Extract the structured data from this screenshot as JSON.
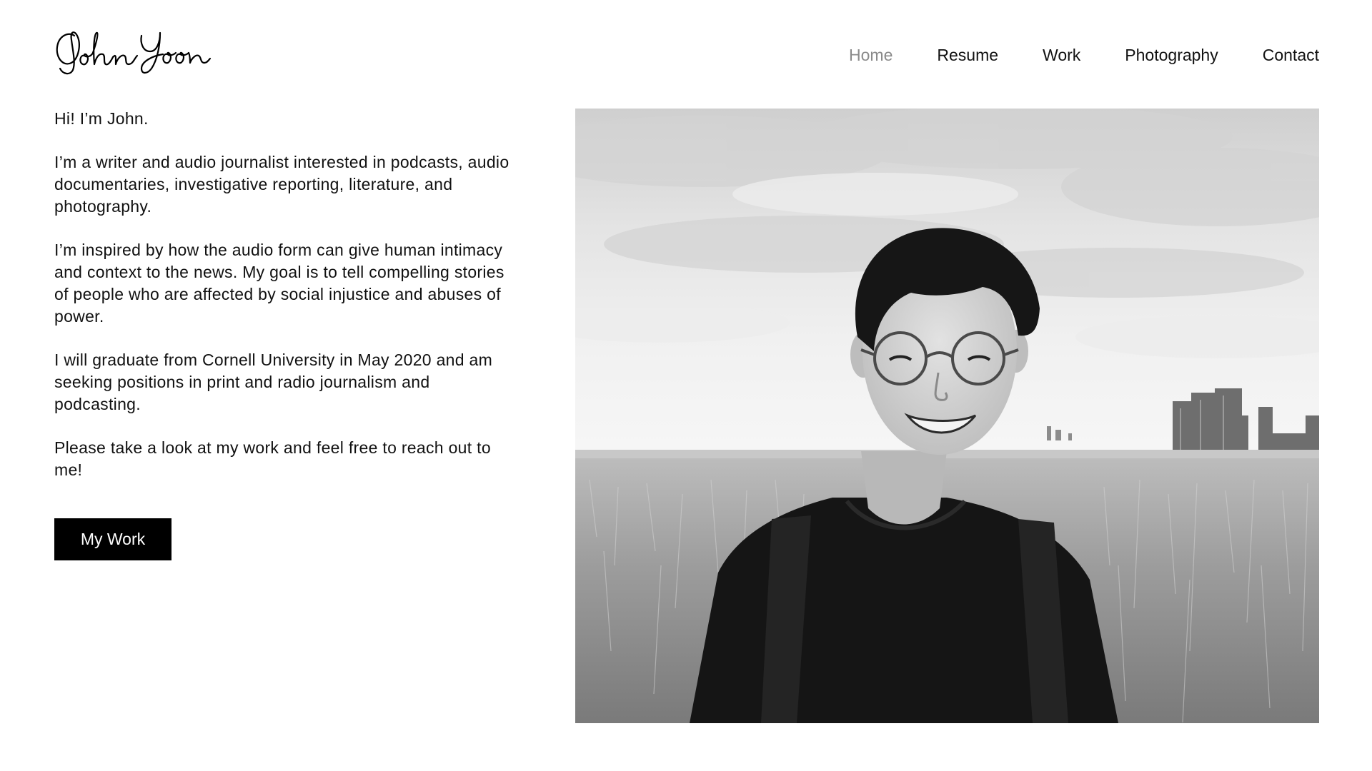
{
  "header": {
    "logo_text": "John Yoon",
    "nav": [
      {
        "label": "Home",
        "active": true
      },
      {
        "label": "Resume",
        "active": false
      },
      {
        "label": "Work",
        "active": false
      },
      {
        "label": "Photography",
        "active": false
      },
      {
        "label": "Contact",
        "active": false
      }
    ]
  },
  "intro": {
    "paragraphs": [
      "Hi! I’m John.",
      "I’m a writer and audio journalist interested in podcasts, audio documentaries, investigative reporting, literature, and photography.",
      "I’m inspired by how the audio form can give human intimacy and context to the news. My goal is to tell compelling stories of people who are affected by social injustice and abuses of power.",
      "I will graduate from Cornell University in May 2020 and am seeking positions in print and radio journalism and podcasting.",
      "Please take a look at my work and feel free to reach out to me!"
    ]
  },
  "cta": {
    "label": "My Work"
  },
  "photo": {
    "style": "black-and-white portrait in a grassy field with a city skyline"
  },
  "colors": {
    "background": "#ffffff",
    "text": "#111111",
    "nav_active": "#8a8a8a",
    "button_bg": "#000000",
    "button_text": "#ffffff"
  }
}
